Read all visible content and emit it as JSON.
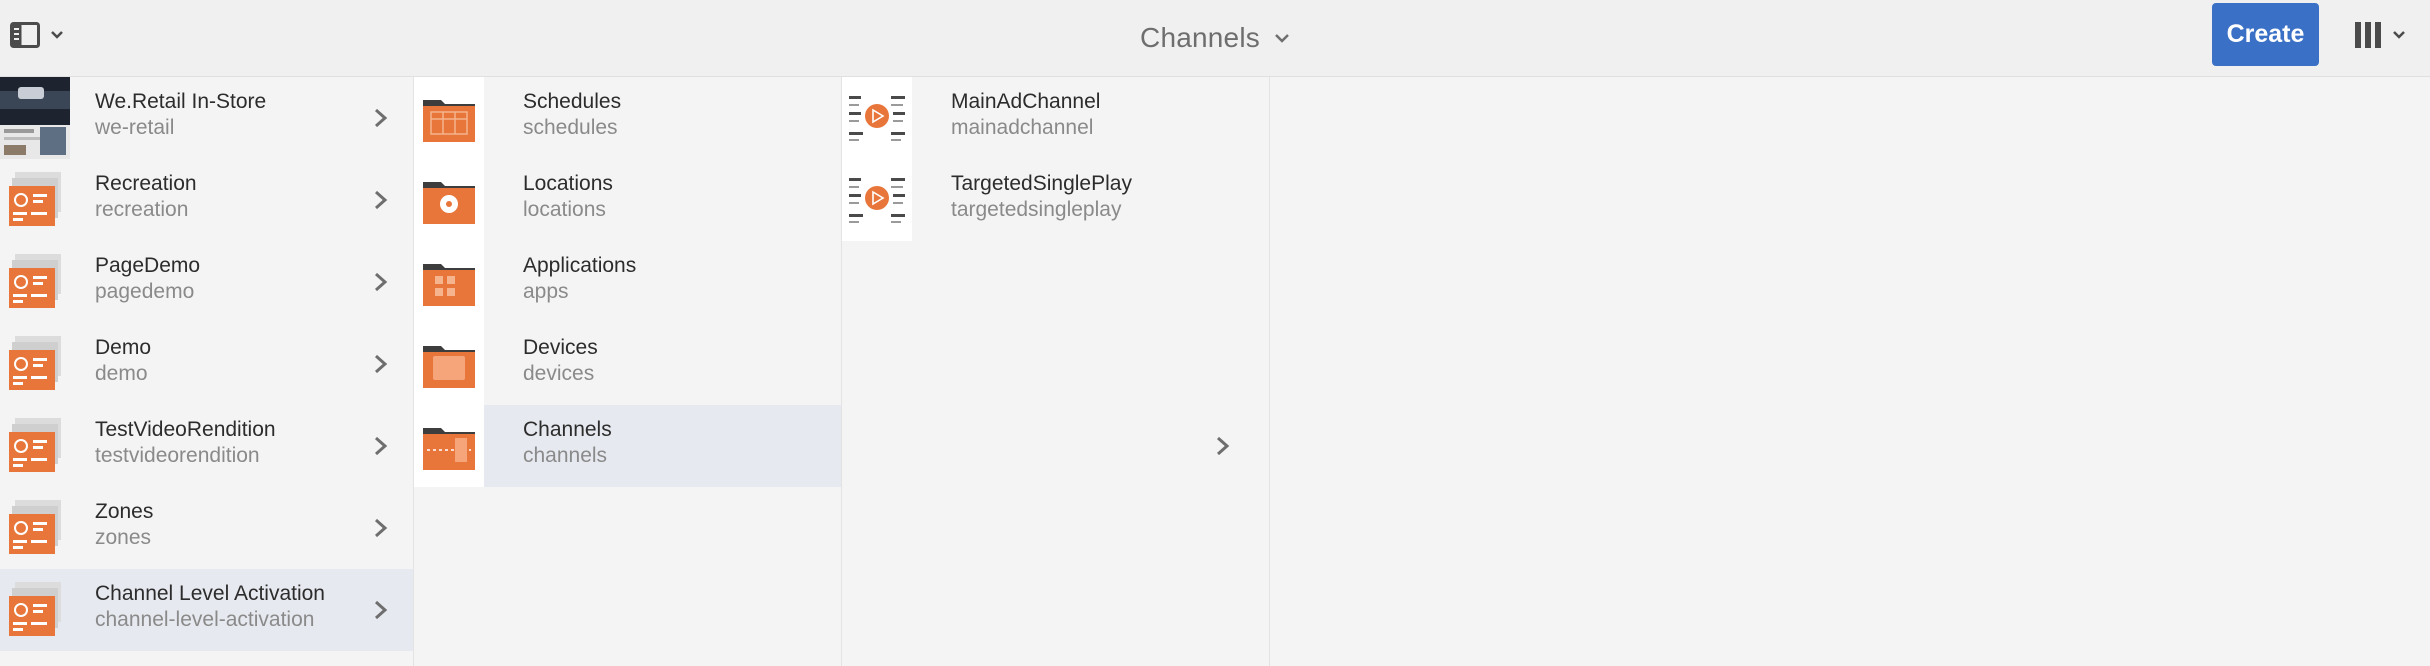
{
  "header": {
    "title": "Channels",
    "create_label": "Create"
  },
  "columns": [
    {
      "items": [
        {
          "title": "We.Retail In-Store",
          "sub": "we-retail",
          "thumb": "photo",
          "selected": false,
          "chevron": true
        },
        {
          "title": "Recreation",
          "sub": "recreation",
          "thumb": "project",
          "selected": false,
          "chevron": true
        },
        {
          "title": "PageDemo",
          "sub": "pagedemo",
          "thumb": "project",
          "selected": false,
          "chevron": true
        },
        {
          "title": "Demo",
          "sub": "demo",
          "thumb": "project",
          "selected": false,
          "chevron": true
        },
        {
          "title": "TestVideoRendition",
          "sub": "testvideorendition",
          "thumb": "project",
          "selected": false,
          "chevron": true
        },
        {
          "title": "Zones",
          "sub": "zones",
          "thumb": "project",
          "selected": false,
          "chevron": true
        },
        {
          "title": "Channel Level Activation",
          "sub": "channel-level-activation",
          "thumb": "project",
          "selected": true,
          "chevron": true
        }
      ]
    },
    {
      "items": [
        {
          "title": "Schedules",
          "sub": "schedules",
          "thumb": "folder-schedules",
          "selected": false,
          "chevron": false
        },
        {
          "title": "Locations",
          "sub": "locations",
          "thumb": "folder-locations",
          "selected": false,
          "chevron": false
        },
        {
          "title": "Applications",
          "sub": "apps",
          "thumb": "folder-applications",
          "selected": false,
          "chevron": false
        },
        {
          "title": "Devices",
          "sub": "devices",
          "thumb": "folder-devices",
          "selected": false,
          "chevron": false
        },
        {
          "title": "Channels",
          "sub": "channels",
          "thumb": "folder-channels",
          "selected": true,
          "chevron": true
        }
      ]
    },
    {
      "items": [
        {
          "title": "MainAdChannel",
          "sub": "mainadchannel",
          "thumb": "channel",
          "selected": false,
          "chevron": false
        },
        {
          "title": "TargetedSinglePlay",
          "sub": "targetedsingleplay",
          "thumb": "channel",
          "selected": false,
          "chevron": false
        }
      ]
    }
  ],
  "colors": {
    "accent": "#3a71c6",
    "orange": "#e8763a",
    "selected_row": "#e6e9ef"
  }
}
